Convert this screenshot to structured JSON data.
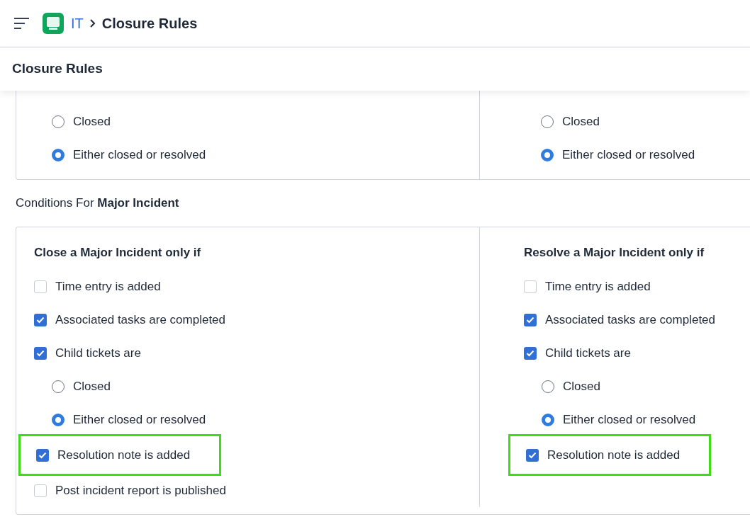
{
  "header": {
    "breadcrumb": [
      {
        "label": "IT",
        "kind": "link"
      },
      {
        "label": "Closure Rules",
        "kind": "current"
      }
    ]
  },
  "page_title": "Closure Rules",
  "top_card": {
    "columns": [
      {
        "options": [
          {
            "label": "Closed",
            "selected": false
          },
          {
            "label": "Either closed or resolved",
            "selected": true
          }
        ]
      },
      {
        "options": [
          {
            "label": "Closed",
            "selected": false
          },
          {
            "label": "Either closed or resolved",
            "selected": true
          }
        ]
      }
    ]
  },
  "section": {
    "heading": "Conditions For **Major Incident**",
    "columns": [
      {
        "title": "Close a Major Incident only if",
        "items": [
          {
            "kind": "checkbox",
            "label": "Time entry is added",
            "checked": false,
            "highlighted": false
          },
          {
            "kind": "checkbox",
            "label": "Associated tasks are completed",
            "checked": true,
            "highlighted": false
          },
          {
            "kind": "checkbox",
            "label": "Child tickets are",
            "checked": true,
            "highlighted": false,
            "children": [
              {
                "kind": "radio",
                "label": "Closed",
                "selected": false
              },
              {
                "kind": "radio",
                "label": "Either closed or resolved",
                "selected": true
              }
            ]
          },
          {
            "kind": "checkbox",
            "label": "Resolution note is added",
            "checked": true,
            "highlighted": true
          },
          {
            "kind": "checkbox",
            "label": "Post incident report is published",
            "checked": false,
            "highlighted": false
          }
        ]
      },
      {
        "title": "Resolve a Major Incident only if",
        "items": [
          {
            "kind": "checkbox",
            "label": "Time entry is added",
            "checked": false,
            "highlighted": false
          },
          {
            "kind": "checkbox",
            "label": "Associated tasks are completed",
            "checked": true,
            "highlighted": false
          },
          {
            "kind": "checkbox",
            "label": "Child tickets are",
            "checked": true,
            "highlighted": false,
            "children": [
              {
                "kind": "radio",
                "label": "Closed",
                "selected": false
              },
              {
                "kind": "radio",
                "label": "Either closed or resolved",
                "selected": true
              }
            ]
          },
          {
            "kind": "checkbox",
            "label": "Resolution note is added",
            "checked": true,
            "highlighted": true
          }
        ]
      }
    ]
  }
}
